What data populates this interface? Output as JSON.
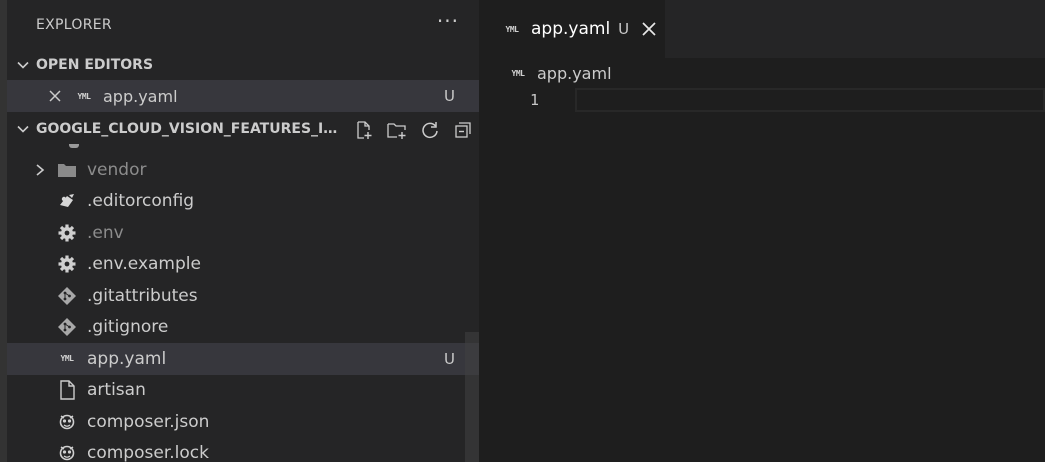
{
  "explorer": {
    "title": "EXPLORER",
    "more_label": "···"
  },
  "open_editors": {
    "label": "OPEN EDITORS",
    "items": [
      {
        "name": "app.yaml",
        "status": "U",
        "icon": "yaml-icon"
      }
    ]
  },
  "project": {
    "label": "GOOGLE_CLOUD_VISION_FEATURES_IN...",
    "actions": [
      "new-file-icon",
      "new-folder-icon",
      "refresh-icon",
      "collapse-all-icon"
    ]
  },
  "tree": {
    "items": [
      {
        "name": "vendor",
        "icon": "folder-icon",
        "status": "",
        "kind": "folder"
      },
      {
        "name": ".editorconfig",
        "icon": "editorconfig-icon",
        "status": ""
      },
      {
        "name": ".env",
        "icon": "gear-icon",
        "status": ""
      },
      {
        "name": ".env.example",
        "icon": "gear-icon",
        "status": ""
      },
      {
        "name": ".gitattributes",
        "icon": "git-icon",
        "status": ""
      },
      {
        "name": ".gitignore",
        "icon": "git-icon",
        "status": ""
      },
      {
        "name": "app.yaml",
        "icon": "yaml-icon",
        "status": "U"
      },
      {
        "name": "artisan",
        "icon": "file-icon",
        "status": ""
      },
      {
        "name": "composer.json",
        "icon": "composer-icon",
        "status": ""
      },
      {
        "name": "composer.lock",
        "icon": "composer-icon",
        "status": ""
      }
    ]
  },
  "editor": {
    "tab": {
      "name": "app.yaml",
      "status": "U",
      "icon": "yaml-icon"
    },
    "breadcrumb": {
      "name": "app.yaml",
      "icon": "yaml-icon"
    },
    "lines": [
      {
        "number": "1",
        "text": ""
      }
    ]
  },
  "colors": {
    "sidebar_bg": "#252526",
    "editor_bg": "#1e1e1e",
    "selected_row": "#37373d",
    "text": "#cccccc"
  }
}
